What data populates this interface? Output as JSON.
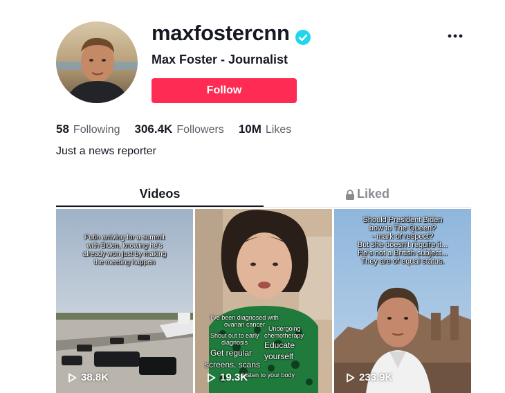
{
  "profile": {
    "username": "maxfostercnn",
    "display_name": "Max Foster - Journalist",
    "follow_label": "Follow",
    "bio": "Just a news reporter",
    "verified": true
  },
  "stats": [
    {
      "value": "58",
      "label": "Following"
    },
    {
      "value": "306.4K",
      "label": "Followers"
    },
    {
      "value": "10M",
      "label": "Likes"
    }
  ],
  "tabs": [
    {
      "label": "Videos",
      "active": true
    },
    {
      "label": "Liked",
      "active": false,
      "locked": true
    }
  ],
  "videos": [
    {
      "caption": [
        "Putin arriving for a summit",
        "with Biden, knowing he's",
        "already won just by making",
        "the meeting happen"
      ],
      "views": "38.8K"
    },
    {
      "overlay": [
        "I've been diagnosed with",
        "ovarian cancer",
        "Undergoing",
        "chemotherapy",
        "Shout out to early",
        "diagnosis",
        "Educate",
        "yourself",
        "Get regular",
        "screens, scans",
        "Listen to your body"
      ],
      "views": "19.3K"
    },
    {
      "caption": [
        "Should President Biden",
        "bow to The Queen?",
        "- mark of respect?",
        "But she doesn't require it...",
        "He's not a British subject...",
        "They are of equal status."
      ],
      "views": "233.9K"
    }
  ],
  "colors": {
    "accent": "#fe2c55",
    "verified": "#20d5ec",
    "text": "#161823",
    "muted": "#5d5e66"
  },
  "icons": [
    "verified-badge-icon",
    "more-options-icon",
    "lock-icon",
    "play-icon"
  ]
}
